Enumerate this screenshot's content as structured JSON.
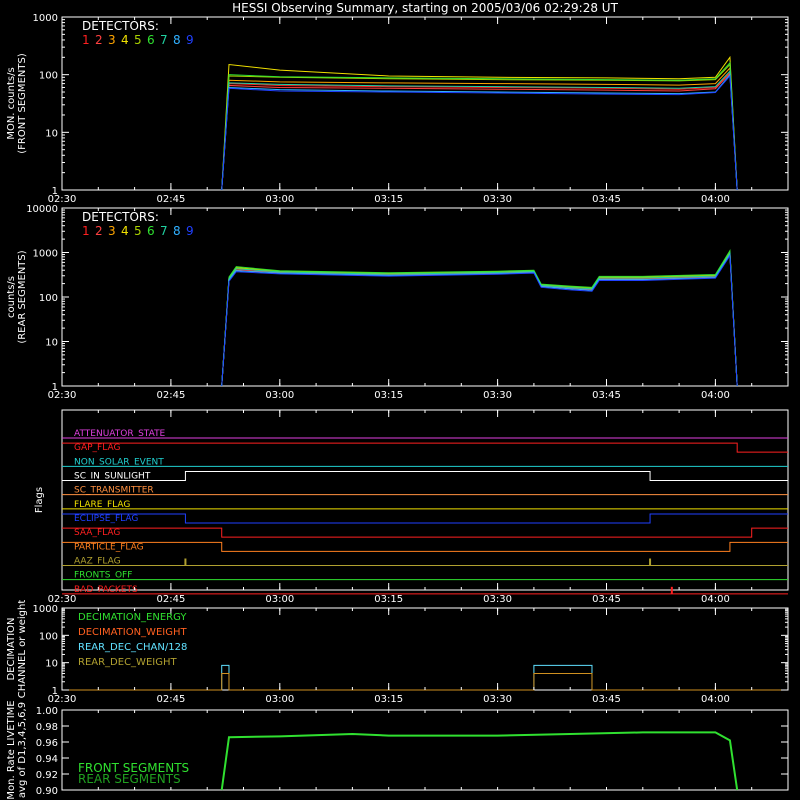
{
  "title": "HESSI Observing Summary, starting on 2005/03/06 02:29:28 UT",
  "colors": {
    "background": "#000000",
    "axes": "#ffffff",
    "det": [
      "#ff2020",
      "#ff4040",
      "#ffa500",
      "#f0e000",
      "#a8d000",
      "#30e030",
      "#20d0a0",
      "#30b0ff",
      "#2040ff"
    ],
    "front_trace": "#30e030",
    "rear_trace": "#20a020"
  },
  "chart_data": [
    {
      "type": "line",
      "name": "front",
      "ylabel": "MON. counts/s",
      "ylabel2": "(FRONT SEGMENTS)",
      "scale": "log",
      "ylim": [
        1,
        1000
      ],
      "yticks": [
        "1",
        "10",
        "100",
        "1000"
      ],
      "xlim": [
        "02:30",
        "04:10"
      ],
      "xticks": [
        "02:30",
        "02:45",
        "03:00",
        "03:15",
        "03:30",
        "03:45",
        "04:00"
      ],
      "legend_title": "DETECTORS:",
      "legend_labels": [
        "1",
        "2",
        "3",
        "4",
        "5",
        "6",
        "7",
        "8",
        "9"
      ],
      "data_window": [
        "02:52",
        "04:03"
      ],
      "x": [
        "02:52",
        "02:53",
        "03:00",
        "03:15",
        "03:30",
        "03:45",
        "03:55",
        "04:00",
        "04:02",
        "04:03"
      ],
      "series": [
        {
          "detector": "1",
          "values": [
            1,
            70,
            65,
            62,
            60,
            58,
            56,
            60,
            110,
            1
          ]
        },
        {
          "detector": "2",
          "values": [
            1,
            65,
            60,
            58,
            56,
            54,
            52,
            57,
            105,
            1
          ]
        },
        {
          "detector": "3",
          "values": [
            1,
            80,
            75,
            72,
            70,
            68,
            66,
            70,
            130,
            1
          ]
        },
        {
          "detector": "4",
          "values": [
            1,
            150,
            120,
            95,
            90,
            88,
            85,
            90,
            200,
            1
          ]
        },
        {
          "detector": "5",
          "values": [
            1,
            95,
            90,
            85,
            82,
            80,
            78,
            82,
            150,
            1
          ]
        },
        {
          "detector": "6",
          "values": [
            1,
            100,
            92,
            88,
            85,
            82,
            80,
            85,
            160,
            1
          ]
        },
        {
          "detector": "7",
          "values": [
            1,
            72,
            68,
            64,
            62,
            60,
            58,
            62,
            115,
            1
          ]
        },
        {
          "detector": "8",
          "values": [
            1,
            60,
            55,
            52,
            50,
            48,
            47,
            50,
            100,
            1
          ]
        },
        {
          "detector": "9",
          "values": [
            1,
            58,
            52,
            50,
            48,
            46,
            45,
            49,
            95,
            1
          ]
        }
      ]
    },
    {
      "type": "line",
      "name": "rear",
      "ylabel": "counts/s",
      "ylabel2": "(REAR SEGMENTS)",
      "scale": "log",
      "ylim": [
        1,
        10000
      ],
      "yticks": [
        "1",
        "10",
        "100",
        "1000",
        "10000"
      ],
      "xlim": [
        "02:30",
        "04:10"
      ],
      "xticks": [
        "02:30",
        "02:45",
        "03:00",
        "03:15",
        "03:30",
        "03:45",
        "04:00"
      ],
      "legend_title": "DETECTORS:",
      "legend_labels": [
        "1",
        "2",
        "3",
        "4",
        "5",
        "6",
        "7",
        "8",
        "9"
      ],
      "x": [
        "02:52",
        "02:53",
        "02:54",
        "03:00",
        "03:15",
        "03:30",
        "03:35",
        "03:36",
        "03:40",
        "03:43",
        "03:44",
        "03:50",
        "04:00",
        "04:02",
        "04:03"
      ],
      "series": [
        {
          "detector": "1",
          "values": [
            1,
            250,
            420,
            360,
            320,
            350,
            370,
            180,
            160,
            150,
            260,
            260,
            290,
            950,
            1
          ]
        },
        {
          "detector": "2",
          "values": [
            1,
            240,
            400,
            350,
            310,
            340,
            360,
            175,
            155,
            145,
            250,
            250,
            280,
            900,
            1
          ]
        },
        {
          "detector": "3",
          "values": [
            1,
            260,
            440,
            370,
            330,
            360,
            380,
            185,
            165,
            155,
            270,
            270,
            300,
            980,
            1
          ]
        },
        {
          "detector": "4",
          "values": [
            1,
            270,
            460,
            380,
            340,
            370,
            390,
            190,
            170,
            160,
            280,
            280,
            310,
            1000,
            1
          ]
        },
        {
          "detector": "5",
          "values": [
            1,
            265,
            450,
            375,
            335,
            365,
            385,
            188,
            168,
            158,
            275,
            275,
            305,
            990,
            1
          ]
        },
        {
          "detector": "6",
          "values": [
            1,
            280,
            480,
            390,
            350,
            380,
            400,
            195,
            175,
            165,
            290,
            290,
            320,
            1100,
            1
          ]
        },
        {
          "detector": "7",
          "values": [
            1,
            255,
            430,
            365,
            325,
            355,
            375,
            182,
            162,
            152,
            265,
            265,
            295,
            960,
            1
          ]
        },
        {
          "detector": "8",
          "values": [
            1,
            235,
            390,
            345,
            305,
            335,
            355,
            172,
            152,
            142,
            245,
            245,
            275,
            880,
            1
          ]
        },
        {
          "detector": "9",
          "values": [
            1,
            225,
            370,
            330,
            295,
            325,
            345,
            165,
            145,
            135,
            235,
            235,
            265,
            850,
            1
          ]
        }
      ]
    },
    {
      "type": "flags",
      "name": "flags",
      "ylabel": "Flags",
      "xlim": [
        "02:30",
        "04:10"
      ],
      "xticks": [
        "02:30",
        "02:45",
        "03:00",
        "03:15",
        "03:30",
        "03:45",
        "04:00"
      ],
      "flags": [
        {
          "label": "ATTENUATOR_STATE",
          "color": "#e040e0",
          "segments": [
            [
              0,
              0
            ]
          ]
        },
        {
          "label": "GAP_FLAG",
          "color": "#ff2020",
          "segments": [
            [
              1,
              0
            ],
            [
              1,
              0
            ],
            [
              0,
              1
            ]
          ],
          "times": [
            "02:30",
            "02:52",
            "04:03"
          ]
        },
        {
          "label": "NON_SOLAR_EVENT",
          "color": "#20d0d0",
          "segments": [
            [
              0,
              0
            ]
          ]
        },
        {
          "label": "SC_IN_SUNLIGHT",
          "color": "#ffffff",
          "times": [
            "02:30",
            "02:47",
            "03:51"
          ],
          "states": [
            0,
            1,
            0
          ]
        },
        {
          "label": "SC_TRANSMITTER",
          "color": "#ff9040",
          "times": [
            "02:30"
          ],
          "states": [
            0
          ]
        },
        {
          "label": "FLARE_FLAG",
          "color": "#f0e000",
          "times": [
            "02:30"
          ],
          "states": [
            0
          ]
        },
        {
          "label": "ECLIPSE_FLAG",
          "color": "#2040ff",
          "times": [
            "02:30",
            "02:47",
            "03:51"
          ],
          "states": [
            1,
            0,
            1
          ]
        },
        {
          "label": "SAA_FLAG",
          "color": "#ff2020",
          "times": [
            "02:30",
            "02:52",
            "04:05"
          ],
          "states": [
            1,
            0,
            1
          ]
        },
        {
          "label": "PARTICLE_FLAG",
          "color": "#ff8020",
          "times": [
            "02:30",
            "02:52",
            "04:02"
          ],
          "states": [
            1,
            0,
            1
          ]
        },
        {
          "label": "AAZ_FLAG",
          "color": "#b0a030",
          "times": [
            "02:30"
          ],
          "states": [
            0
          ],
          "spikes": [
            "02:47",
            "03:51"
          ]
        },
        {
          "label": "FRONTS_OFF",
          "color": "#30e030",
          "times": [
            "02:30"
          ],
          "states": [
            0
          ]
        },
        {
          "label": "BAD_PACKETS",
          "color": "#ff2020",
          "times": [
            "02:30"
          ],
          "states": [
            0
          ],
          "spikes": [
            "03:54"
          ]
        }
      ]
    },
    {
      "type": "line",
      "name": "decimation",
      "ylabel": "DECIMATION",
      "ylabel2": "CHANNEL or weight",
      "scale": "log",
      "ylim": [
        1,
        1000
      ],
      "yticks": [
        "1",
        "10",
        "100",
        "1000"
      ],
      "xlim": [
        "02:30",
        "04:10"
      ],
      "xticks": [
        "02:30",
        "02:45",
        "03:00",
        "03:15",
        "03:30",
        "03:45",
        "04:00"
      ],
      "legend": [
        {
          "label": "DECIMATION_ENERGY",
          "color": "#30e030"
        },
        {
          "label": "DECIMATION_WEIGHT",
          "color": "#ff6020"
        },
        {
          "label": "REAR_DEC_CHAN/128",
          "color": "#60e0ff"
        },
        {
          "label": "REAR_DEC_WEIGHT",
          "color": "#b0a030"
        }
      ],
      "steps": [
        {
          "series": "REAR_DEC_CHAN/128",
          "color": "#60e0ff",
          "times": [
            "02:30",
            "02:52",
            "02:53",
            "03:35",
            "03:43"
          ],
          "values": [
            1,
            8,
            1,
            8,
            1
          ]
        },
        {
          "series": "REAR_DEC_WEIGHT",
          "color": "#d09020",
          "times": [
            "02:30",
            "02:52",
            "02:53",
            "03:35",
            "03:43"
          ],
          "values": [
            1,
            4,
            1,
            4,
            1
          ]
        }
      ]
    },
    {
      "type": "line",
      "name": "livetime",
      "ylabel": "Mon. Rate LIVETIME",
      "ylabel2": "avg of D1,3,4,5,6,9",
      "scale": "linear",
      "ylim": [
        0.9,
        1.0
      ],
      "yticks": [
        "0.90",
        "0.92",
        "0.94",
        "0.96",
        "0.98",
        "1.00"
      ],
      "xlim": [
        "02:30",
        "04:10"
      ],
      "legend": [
        {
          "label": "FRONT SEGMENTS",
          "color": "#30e030"
        },
        {
          "label": "REAR SEGMENTS",
          "color": "#20a020"
        }
      ],
      "x": [
        "02:52",
        "02:53",
        "03:00",
        "03:10",
        "03:15",
        "03:30",
        "03:40",
        "03:50",
        "04:00",
        "04:02",
        "04:03"
      ],
      "series": [
        {
          "name": "FRONT SEGMENTS",
          "values": [
            0.9,
            0.966,
            0.967,
            0.97,
            0.968,
            0.968,
            0.97,
            0.972,
            0.972,
            0.962,
            0.9
          ]
        }
      ]
    }
  ]
}
